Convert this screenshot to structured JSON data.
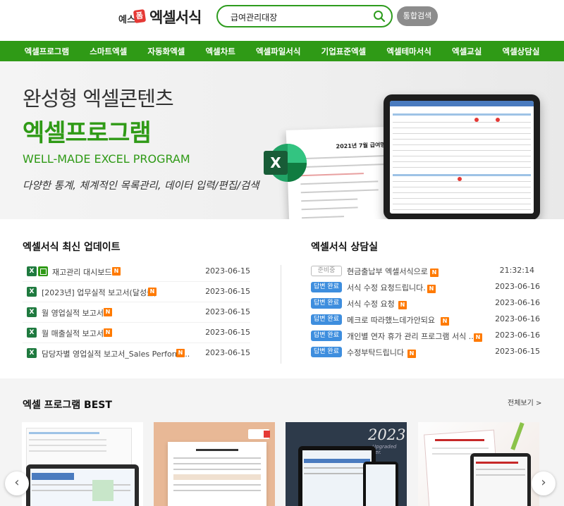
{
  "header": {
    "logo_mark": "예스",
    "logo_badge": "폼",
    "logo_text": "엑셀서식",
    "search_value": "급여관리대장",
    "search_button": "통합검색"
  },
  "nav": [
    "엑셀프로그램",
    "스마트엑셀",
    "자동화엑셀",
    "엑셀차트",
    "엑셀파일서식",
    "기업표준엑셀",
    "엑셀테마서식",
    "엑셀교실",
    "엑셀상담실"
  ],
  "hero": {
    "title1": "완성형 엑셀콘텐츠",
    "title2": "엑셀프로그램",
    "subtitle": "WELL-MADE EXCEL PROGRAM",
    "description": "다양한 통계, 체계적인 목록관리, 데이터 입력/편집/검색",
    "paper_title": "2021년 7월 급여명/",
    "excel_letter": "X"
  },
  "updates": {
    "title": "엑셀서식 최신 업데이트",
    "items": [
      {
        "label": "재고관리 대시보드",
        "date": "2023-06-15"
      },
      {
        "label": "[2023년] 업무실적 보고서(달성률)",
        "date": "2023-06-15"
      },
      {
        "label": "월 영업실적 보고서",
        "date": "2023-06-15"
      },
      {
        "label": "월 매출실적 보고서",
        "date": "2023-06-15"
      },
      {
        "label": "담당자별 영업실적 보고서_Sales Perform...",
        "date": "2023-06-15"
      }
    ],
    "new_badge": "N",
    "excel_icon": "X"
  },
  "consult": {
    "title": "엑셀서식 상담실",
    "items": [
      {
        "status": "준비중",
        "label": "현금출납부 엑셀서식으로",
        "date": "21:32:14"
      },
      {
        "status": "답변 완료",
        "label": "서식 수정 요청드립니다.",
        "date": "2023-06-16"
      },
      {
        "status": "답변 완료",
        "label": "서식 수정 요청",
        "date": "2023-06-16"
      },
      {
        "status": "답변 완료",
        "label": "메크로 따라했느데가안되요",
        "date": "2023-06-16"
      },
      {
        "status": "답변 완료",
        "label": "개인별 연자 휴가 관리 프로그램 서식 ...",
        "date": "2023-06-16"
      },
      {
        "status": "답변 완료",
        "label": "수정부탁드립니다",
        "date": "2023-06-15"
      }
    ]
  },
  "best": {
    "title": "엑셀 프로그램 BEST",
    "more": "전체보기 >",
    "card3_year": "2023",
    "card3_sub": "Upgraded ver."
  },
  "icons": {
    "search": "search-icon",
    "prev": "chevron-left-icon",
    "next": "chevron-right-icon"
  },
  "colors": {
    "brand_green": "#2f9a16",
    "status_blue": "#3e8ede",
    "new_orange": "#ff7a00"
  }
}
